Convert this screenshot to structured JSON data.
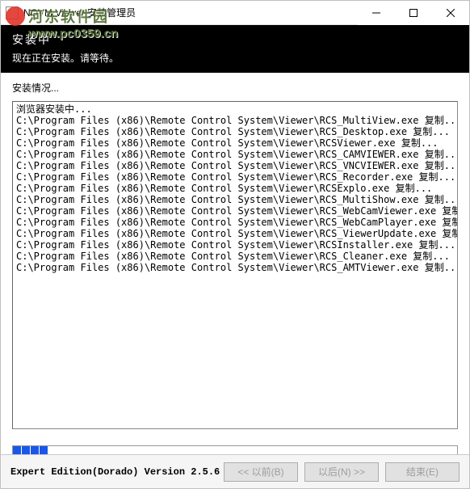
{
  "titlebar": {
    "title": "NOVM Viewer 安装管理员"
  },
  "watermark": {
    "cn": "河东软件园",
    "url": "www.pc0359.cn"
  },
  "header": {
    "title": "安装中",
    "subtitle": "现在正在安装。请等待。"
  },
  "status_label": "安装情况...",
  "log": {
    "header": "浏览器安装中...",
    "lines": [
      "C:\\Program Files (x86)\\Remote Control System\\Viewer\\RCS_MultiView.exe 复制...",
      "C:\\Program Files (x86)\\Remote Control System\\Viewer\\RCS_Desktop.exe 复制...",
      "C:\\Program Files (x86)\\Remote Control System\\Viewer\\RCSViewer.exe 复制...",
      "C:\\Program Files (x86)\\Remote Control System\\Viewer\\RCS_CAMVIEWER.exe 复制...",
      "C:\\Program Files (x86)\\Remote Control System\\Viewer\\RCS_VNCVIEWER.exe 复制...",
      "C:\\Program Files (x86)\\Remote Control System\\Viewer\\RCS_Recorder.exe 复制...",
      "C:\\Program Files (x86)\\Remote Control System\\Viewer\\RCSExplo.exe 复制...",
      "C:\\Program Files (x86)\\Remote Control System\\Viewer\\RCS_MultiShow.exe 复制...",
      "C:\\Program Files (x86)\\Remote Control System\\Viewer\\RCS_WebCamViewer.exe 复制...",
      "C:\\Program Files (x86)\\Remote Control System\\Viewer\\RCS_WebCamPlayer.exe 复制...",
      "C:\\Program Files (x86)\\Remote Control System\\Viewer\\RCS_ViewerUpdate.exe 复制...",
      "C:\\Program Files (x86)\\Remote Control System\\Viewer\\RCSInstaller.exe 复制...",
      "C:\\Program Files (x86)\\Remote Control System\\Viewer\\RCS_Cleaner.exe 复制...",
      "C:\\Program Files (x86)\\Remote Control System\\Viewer\\RCS_AMTViewer.exe 复制..."
    ]
  },
  "progress": {
    "segments": 4,
    "total_width": 552
  },
  "footer": {
    "version": "Expert Edition(Dorado) Version 2.5.6",
    "back": "<< 以前(B)",
    "next": "以后(N) >>",
    "finish": "结束(E)"
  }
}
